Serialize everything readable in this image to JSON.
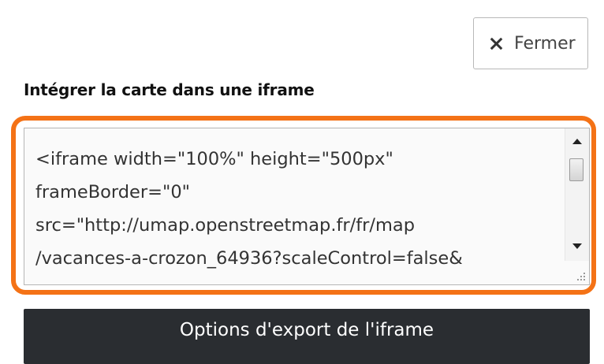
{
  "panel": {
    "close_button": {
      "label": "Fermer",
      "icon": "close-icon"
    },
    "embed_title": "Intégrer la carte dans une iframe",
    "embed_code_lines": [
      "<iframe width=\"100%\" height=\"500px\"",
      "frameBorder=\"0\"",
      "src=\"http://umap.openstreetmap.fr/fr/map",
      "/vacances-a-crozon_64936?scaleControl=false&"
    ],
    "export_options_button": {
      "label": "Options d'export de l'iframe"
    }
  },
  "colors": {
    "highlight": "#f47216",
    "export_button_bg": "#2a2d31"
  }
}
